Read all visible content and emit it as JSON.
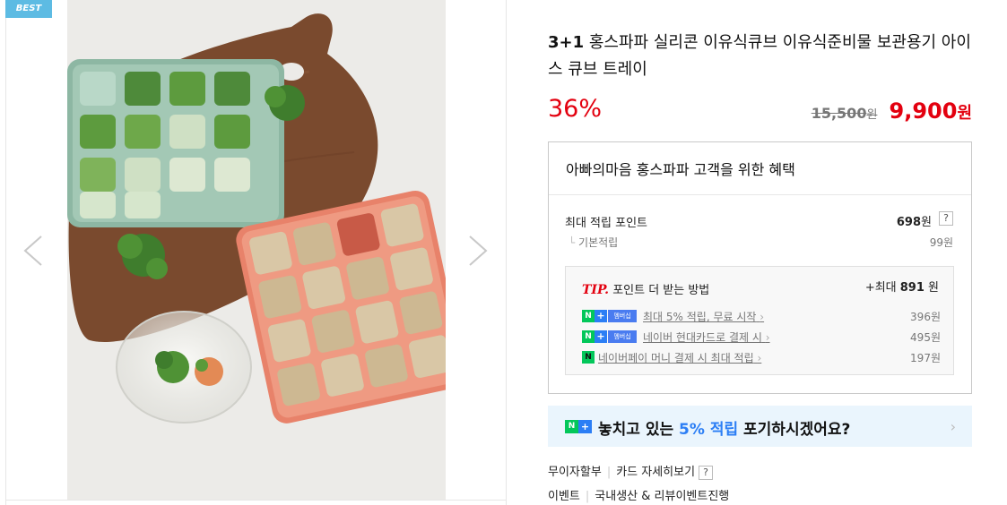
{
  "badge": {
    "best": "BEST"
  },
  "image": {
    "alt": "3+1 홍스파파 실리콘 이유식큐브 이유식준비물 보관용기 아이스 큐브 트레이"
  },
  "colors": {
    "accent_red": "#e3000f",
    "naver_green": "#03c75a",
    "naver_blue": "#2b7ef5",
    "best_badge": "#5dbbe3"
  },
  "product": {
    "title_lead": "3+1",
    "title_rest": " 홍스파파 실리콘 이유식큐브 이유식준비물 보관용기 아이스 큐브 트레이",
    "discount": "36%",
    "original_price": "15,500",
    "original_unit": "원",
    "sale_price": "9,900",
    "sale_unit": "원"
  },
  "benefits": {
    "title": "아빠의마음 홍스파파 고객을 위한 혜택",
    "max_points_label": "최대 적립 포인트",
    "max_points_value": "698",
    "max_points_unit": "원",
    "help": "?",
    "basic_label": "기본적립",
    "basic_value": "99원",
    "tip": {
      "mark": "TIP.",
      "heading": " 포인트 더 받는 방법",
      "max_prefix": "+최대 ",
      "max_value": "891",
      "max_unit": " 원",
      "items": [
        {
          "badge_n": "N",
          "badge_plus": "+",
          "badge_text": "멤버십",
          "label": "최대 5% 적립, 무료 시작",
          "chevron": "›",
          "amount": "396원"
        },
        {
          "badge_n": "N",
          "badge_plus": "+",
          "badge_text": "멤버십",
          "label": "네이버 현대카드로 결제 시",
          "chevron": "›",
          "amount": "495원"
        },
        {
          "badge_n": "N",
          "label": "네이버페이 머니 결제 시 최대 적립",
          "chevron": "›",
          "amount": "197원"
        }
      ]
    }
  },
  "promo": {
    "badge_n": "N",
    "badge_plus": "+",
    "text_before": "놓치고 있는 ",
    "text_highlight": "5% 적립",
    "text_after": " 포기하시겠어요?",
    "chevron": "›"
  },
  "info": {
    "installment": "무이자할부",
    "card_details": "카드 자세히보기",
    "help": "?",
    "event_label": "이벤트",
    "event_text": "국내생산 & 리뷰이벤트진행"
  }
}
